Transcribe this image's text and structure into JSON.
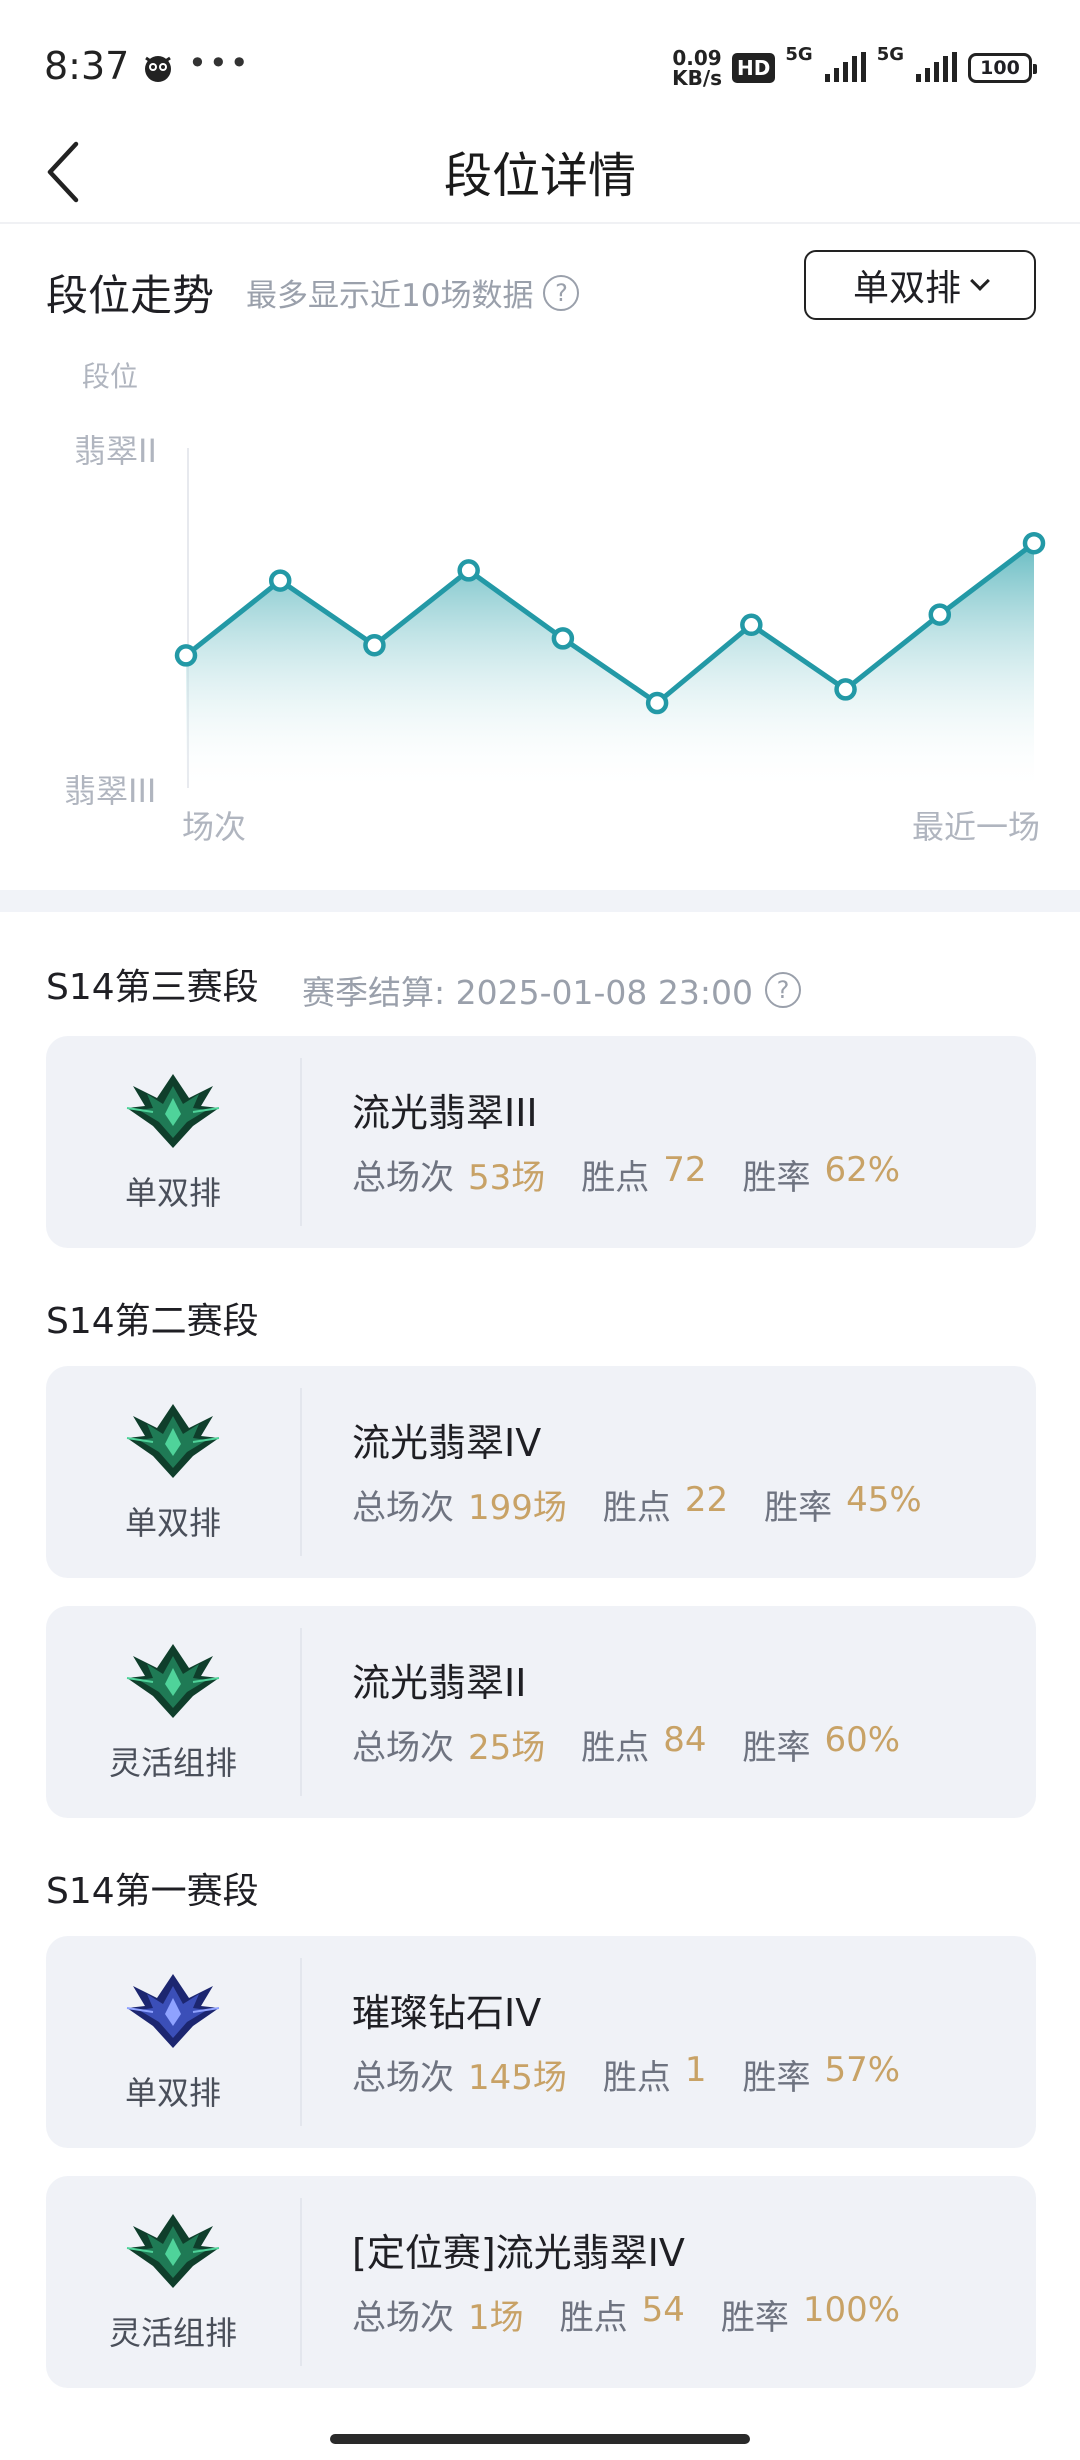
{
  "status_bar": {
    "time": "8:37",
    "dots": "•••",
    "speed_value": "0.09",
    "speed_unit": "KB/s",
    "hd": "HD",
    "net1": "5G",
    "net2": "5G",
    "battery": "100"
  },
  "nav": {
    "title": "段位详情"
  },
  "trend": {
    "title": "段位走势",
    "subtitle": "最多显示近10场数据",
    "help": "?",
    "mode_select": "单双排"
  },
  "chart_data": {
    "type": "area",
    "ylabel": "段位",
    "y_ticks": [
      "翡翠II",
      "翡翠III"
    ],
    "x_labels": [
      "场次",
      "最近一场"
    ],
    "values": [
      0.39,
      0.61,
      0.42,
      0.64,
      0.44,
      0.25,
      0.48,
      0.29,
      0.51,
      0.72
    ],
    "ylim": [
      0,
      1
    ],
    "grid": false,
    "line_color": "#2399a6",
    "fill_top_color": "#5fb8bf",
    "fill_bottom_color": "#ffffff"
  },
  "seasons": [
    {
      "title": "S14第三赛段",
      "note": "赛季结算: 2025-01-08 23:00",
      "help": "?",
      "cards": [
        {
          "emblem": "emerald-emblem",
          "queue": "单双排",
          "rank": "流光翡翠III",
          "games_label": "总场次",
          "games": "53场",
          "lp_label": "胜点",
          "lp": "72",
          "wr_label": "胜率",
          "wr": "62%"
        }
      ]
    },
    {
      "title": "S14第二赛段",
      "cards": [
        {
          "emblem": "emerald-emblem",
          "queue": "单双排",
          "rank": "流光翡翠IV",
          "games_label": "总场次",
          "games": "199场",
          "lp_label": "胜点",
          "lp": "22",
          "wr_label": "胜率",
          "wr": "45%"
        },
        {
          "emblem": "emerald-emblem",
          "queue": "灵活组排",
          "rank": "流光翡翠II",
          "games_label": "总场次",
          "games": "25场",
          "lp_label": "胜点",
          "lp": "84",
          "wr_label": "胜率",
          "wr": "60%"
        }
      ]
    },
    {
      "title": "S14第一赛段",
      "cards": [
        {
          "emblem": "diamond-emblem",
          "queue": "单双排",
          "rank": "璀璨钻石IV",
          "games_label": "总场次",
          "games": "145场",
          "lp_label": "胜点",
          "lp": "1",
          "wr_label": "胜率",
          "wr": "57%"
        },
        {
          "emblem": "emerald-emblem",
          "queue": "灵活组排",
          "rank": "[定位赛]流光翡翠IV",
          "games_label": "总场次",
          "games": "1场",
          "lp_label": "胜点",
          "lp": "54",
          "wr_label": "胜率",
          "wr": "100%"
        }
      ]
    }
  ],
  "colors": {
    "accent_value": "#c8a266",
    "emerald": "#1f7a55",
    "diamond": "#3b4fb8"
  }
}
